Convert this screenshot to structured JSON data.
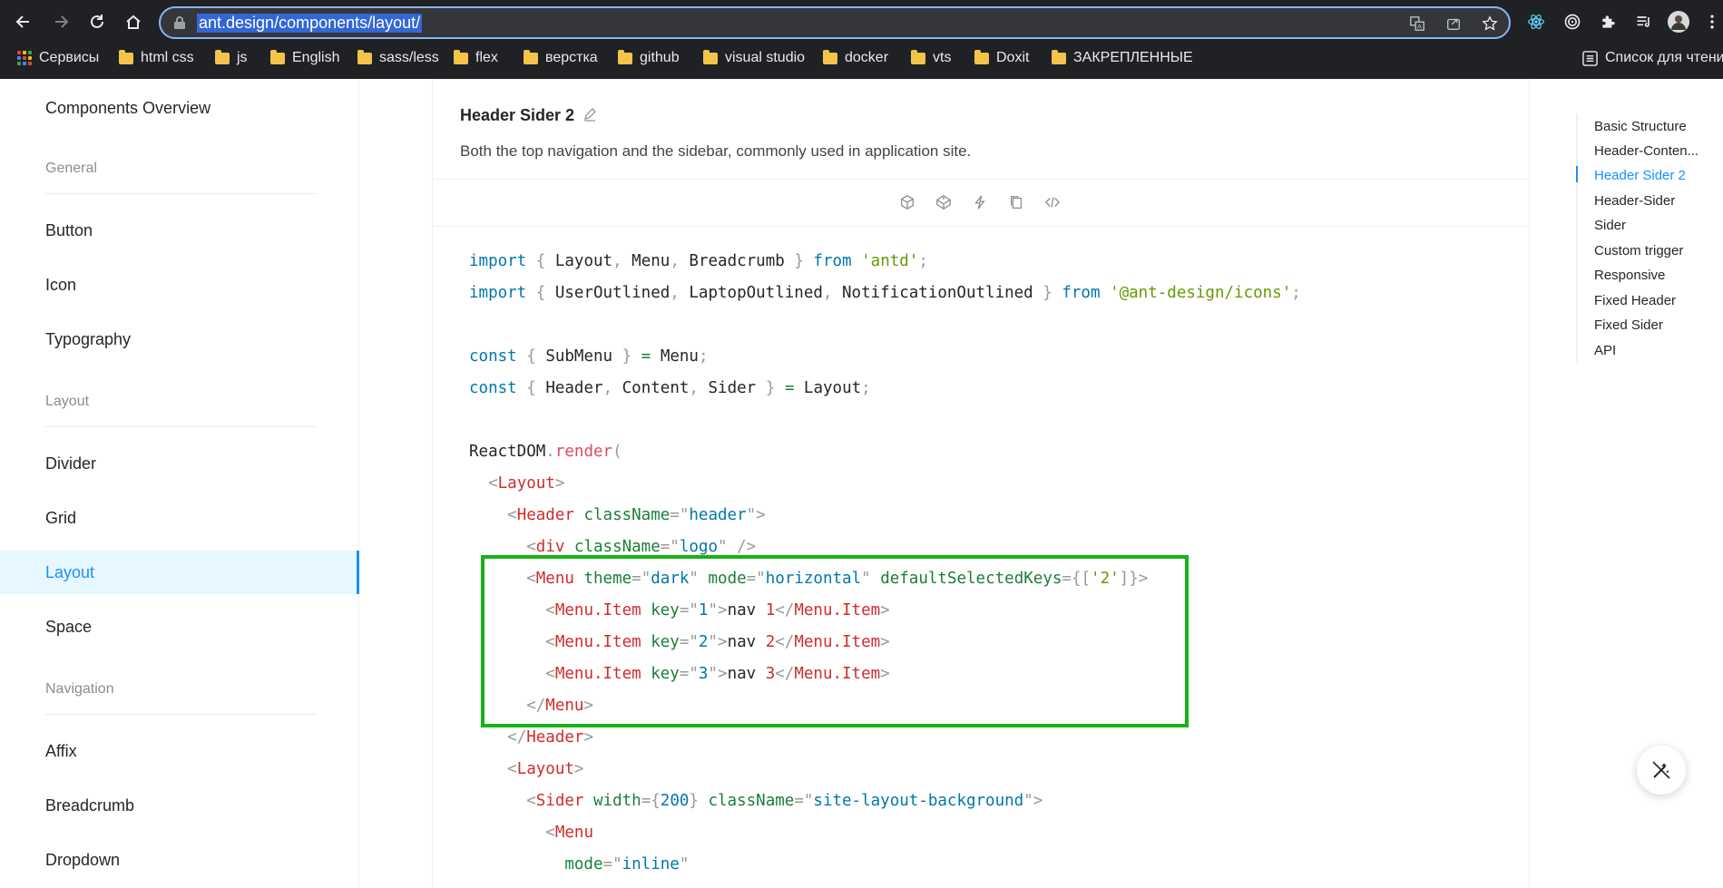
{
  "browser": {
    "url": "ant.design/components/layout/",
    "bookmarks": [
      {
        "label": "Сервисы",
        "icon": "apps-icon"
      },
      {
        "label": "html css",
        "icon": "folder-icon"
      },
      {
        "label": "js",
        "icon": "folder-icon"
      },
      {
        "label": "English",
        "icon": "folder-icon"
      },
      {
        "label": "sass/less",
        "icon": "folder-icon"
      },
      {
        "label": "flex",
        "icon": "folder-icon"
      },
      {
        "label": "верстка",
        "icon": "folder-icon"
      },
      {
        "label": "github",
        "icon": "folder-icon"
      },
      {
        "label": "visual studio",
        "icon": "folder-icon"
      },
      {
        "label": "docker",
        "icon": "folder-icon"
      },
      {
        "label": "vts",
        "icon": "folder-icon"
      },
      {
        "label": "Doxit",
        "icon": "folder-icon"
      },
      {
        "label": "ЗАКРЕПЛЕННЫЕ",
        "icon": "folder-icon"
      }
    ],
    "reading_list": "Список для чтения"
  },
  "sidebar": {
    "overview": "Components Overview",
    "groups": {
      "general": "General",
      "layout": "Layout",
      "navigation": "Navigation"
    },
    "items": {
      "button": "Button",
      "icon": "Icon",
      "typography": "Typography",
      "divider": "Divider",
      "grid": "Grid",
      "layout": "Layout",
      "space": "Space",
      "affix": "Affix",
      "breadcrumb": "Breadcrumb",
      "dropdown": "Dropdown"
    },
    "selected": "Layout"
  },
  "demo": {
    "title": "Header Sider 2",
    "description": "Both the top navigation and the sidebar, commonly used in application site."
  },
  "code": {
    "language": "jsx",
    "lines": [
      "import { Layout, Menu, Breadcrumb } from 'antd';",
      "import { UserOutlined, LaptopOutlined, NotificationOutlined } from '@ant-design/icons';",
      "",
      "const { SubMenu } = Menu;",
      "const { Header, Content, Sider } = Layout;",
      "",
      "ReactDOM.render(",
      "  <Layout>",
      "    <Header className=\"header\">",
      "      <div className=\"logo\" />",
      "      <Menu theme=\"dark\" mode=\"horizontal\" defaultSelectedKeys={['2']}>",
      "        <Menu.Item key=\"1\">nav 1</Menu.Item>",
      "        <Menu.Item key=\"2\">nav 2</Menu.Item>",
      "        <Menu.Item key=\"3\">nav 3</Menu.Item>",
      "      </Menu>",
      "    </Header>",
      "    <Layout>",
      "      <Sider width={200} className=\"site-layout-background\">",
      "        <Menu",
      "          mode=\"inline\""
    ],
    "highlight_color": "#16b316"
  },
  "anchor_nav": {
    "links": [
      "Basic Structure",
      "Header-Conten...",
      "Header Sider 2",
      "Header-Sider",
      "Sider",
      "Custom trigger",
      "Responsive",
      "Fixed Header",
      "Fixed Sider",
      "API"
    ],
    "active": "Header Sider 2"
  },
  "colors": {
    "accent": "#1890ff",
    "selected_bg": "#e6f7ff",
    "chrome_bg": "#202124"
  }
}
